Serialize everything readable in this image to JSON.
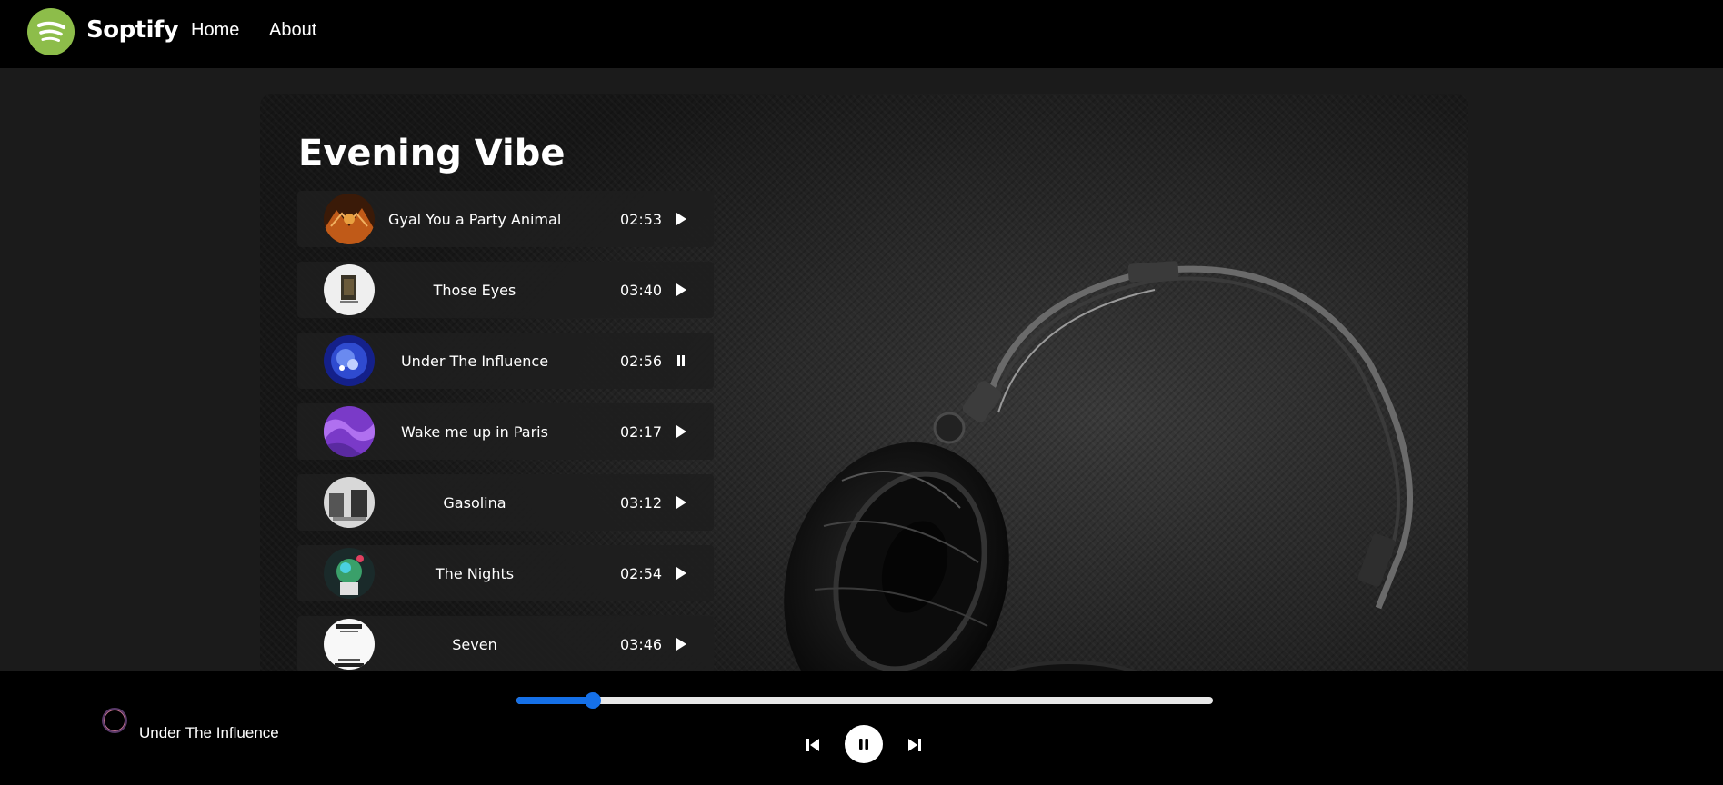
{
  "navbar": {
    "brand": "Soptify",
    "links": [
      {
        "label": "Home"
      },
      {
        "label": "About"
      }
    ],
    "brand_color": "#8dbd4a"
  },
  "playlist": {
    "title": "Evening Vibe",
    "songs": [
      {
        "name": "Gyal You a Party Animal",
        "duration": "02:53",
        "state": "play",
        "cover_color": "#b8501a"
      },
      {
        "name": "Those Eyes",
        "duration": "03:40",
        "state": "play",
        "cover_color": "#e8e8e8"
      },
      {
        "name": "Under The Influence",
        "duration": "02:56",
        "state": "pause",
        "cover_color": "#2a3aa8"
      },
      {
        "name": "Wake me up in Paris",
        "duration": "02:17",
        "state": "play",
        "cover_color": "#8a4ad0"
      },
      {
        "name": "Gasolina",
        "duration": "03:12",
        "state": "play",
        "cover_color": "#9a9a9a"
      },
      {
        "name": "The Nights",
        "duration": "02:54",
        "state": "play",
        "cover_color": "#3a7a6a"
      },
      {
        "name": "Seven",
        "duration": "03:46",
        "state": "play",
        "cover_color": "#f4f4f4"
      }
    ]
  },
  "player": {
    "now_playing": "Under The Influence",
    "progress_percent": 11,
    "accent_color": "#1570e8",
    "controls": {
      "previous_icon": "skip-previous-icon",
      "play_pause_icon": "pause-icon",
      "next_icon": "skip-next-icon"
    }
  }
}
